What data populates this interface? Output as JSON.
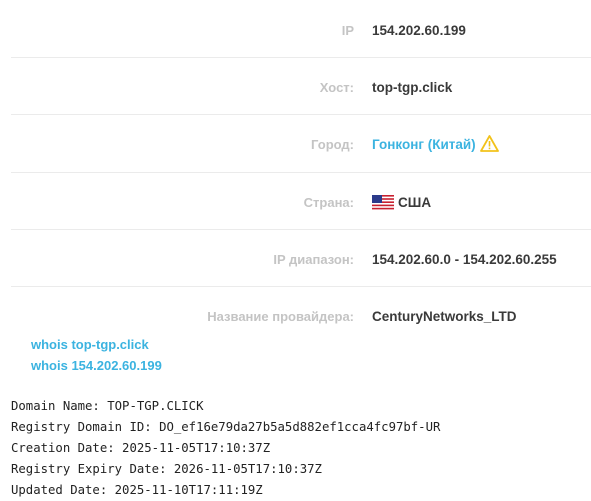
{
  "info": {
    "ip": {
      "label": "IP",
      "value": "154.202.60.199"
    },
    "host": {
      "label": "Хост:",
      "value": "top-tgp.click"
    },
    "city": {
      "label": "Город:",
      "value": "Гонконг (Китай)",
      "icon": "warning-icon"
    },
    "country": {
      "label": "Страна:",
      "value": "США",
      "icon": "us-flag-icon"
    },
    "ip_range": {
      "label": "IP диапазон:",
      "value": "154.202.60.0 - 154.202.60.255"
    },
    "provider": {
      "label": "Название провайдера:",
      "value": "CenturyNetworks_LTD"
    }
  },
  "whois_links": [
    "whois top-tgp.click",
    "whois 154.202.60.199"
  ],
  "whois_raw": [
    "Domain Name: TOP-TGP.CLICK",
    "Registry Domain ID: DO_ef16e79da27b5a5d882ef1cca4fc97bf-UR",
    "Creation Date: 2025-11-05T17:10:37Z",
    "Registry Expiry Date: 2026-11-05T17:10:37Z",
    "Updated Date: 2025-11-10T17:11:19Z"
  ],
  "colors": {
    "label": "#c4c4c4",
    "value": "#3a3a3a",
    "link": "#3bb3e0",
    "warning": "#f2c21b",
    "divider": "#ebebeb"
  }
}
